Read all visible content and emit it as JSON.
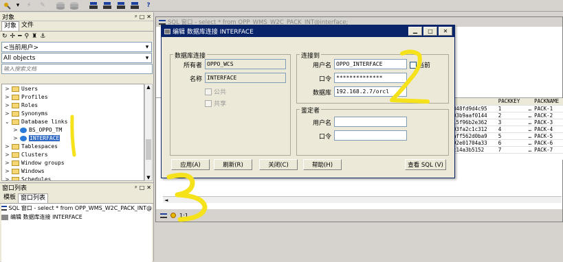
{
  "toolbar": {
    "icons": [
      "dropdown-icon",
      "dropdown-arrow-icon",
      "lightning-icon",
      "pen-icon",
      "disk-icon",
      "disk2-icon",
      "ship-icon",
      "ship2-icon",
      "ship3-icon",
      "ship4-icon",
      "help-icon"
    ],
    "help": "?"
  },
  "left_panel": {
    "title": "对象",
    "tabs": [
      "对象",
      "文件"
    ],
    "user_select": "<当前用户>",
    "objects_select": "All objects",
    "search_placeholder": "输入搜索文档",
    "tree": [
      {
        "label": "Users",
        "level": 0,
        "expanded": false
      },
      {
        "label": "Profiles",
        "level": 0,
        "expanded": false
      },
      {
        "label": "Roles",
        "level": 0,
        "expanded": false
      },
      {
        "label": "Synonyms",
        "level": 0,
        "expanded": false
      },
      {
        "label": "Database links",
        "level": 0,
        "expanded": true
      },
      {
        "label": "BS_OPPO_TM",
        "level": 1,
        "expanded": false
      },
      {
        "label": "INTERFACE",
        "level": 1,
        "expanded": false,
        "selected": true
      },
      {
        "label": "Tablespaces",
        "level": 0,
        "expanded": false
      },
      {
        "label": "Clusters",
        "level": 0,
        "expanded": false
      },
      {
        "label": "Window groups",
        "level": 0,
        "expanded": false
      },
      {
        "label": "Windows",
        "level": 0,
        "expanded": false
      },
      {
        "label": "Schedules",
        "level": 0,
        "expanded": false
      }
    ]
  },
  "window_list": {
    "title": "窗口列表",
    "tabs": [
      "模板",
      "窗口列表"
    ],
    "items": [
      "SQL 窗口 - select * from OPP_WMS_W2C_PACK_INT@",
      "编辑 数据库连接 INTERFACE"
    ]
  },
  "sql_window": {
    "title": "SQL 窗口 - select * from OPP_WMS_W2C_PACK_INT@interface;",
    "status_pos": "1:1",
    "grid": {
      "headers": [
        "",
        "PACKKEY",
        "",
        "PACKNAME"
      ],
      "rows": [
        [
          "848fd9d4c95",
          "1",
          "PACK-1"
        ],
        [
          "03b9aaf0144",
          "2",
          "PACK-2"
        ],
        [
          "15f96b2e362",
          "3",
          "PACK-3"
        ],
        [
          "03fa2c1c312",
          "4",
          "PACK-4"
        ],
        [
          "aff562d0ba9",
          "5",
          "PACK-5"
        ],
        [
          "92e01704a33",
          "6",
          "PACK-6"
        ],
        [
          "c14a3b5152",
          "7",
          "PACK-7"
        ]
      ]
    }
  },
  "dialog": {
    "title": "编辑 数据库连接 INTERFACE",
    "db_link_group": "数据库连接",
    "owner_label": "所有者",
    "owner_value": "OPPO_WCS",
    "name_label": "名称",
    "name_value": "INTERFACE",
    "public_label": "公共",
    "shared_label": "共享",
    "connect_group": "连接到",
    "user_label": "用户名",
    "user_value": "OPPO_INTERFACE",
    "current_label": "当前",
    "password_label": "口令",
    "password_value": "**************",
    "database_label": "数据库",
    "database_value": "192.168.2.7/orcl",
    "auth_group": "鉴定者",
    "auth_user_label": "用户名",
    "auth_user_value": "",
    "auth_password_label": "口令",
    "auth_password_value": "",
    "buttons": {
      "apply": "应用(A)",
      "refresh": "刷新(R)",
      "close": "关闭(C)",
      "help": "帮助(H)",
      "view_sql": "查看 SQL (V)"
    }
  },
  "annotations": [
    "1",
    "2",
    "3"
  ],
  "colors": {
    "dialog_title": "#0a246a",
    "selection": "#316ac5",
    "annotation": "#f5e21a"
  }
}
